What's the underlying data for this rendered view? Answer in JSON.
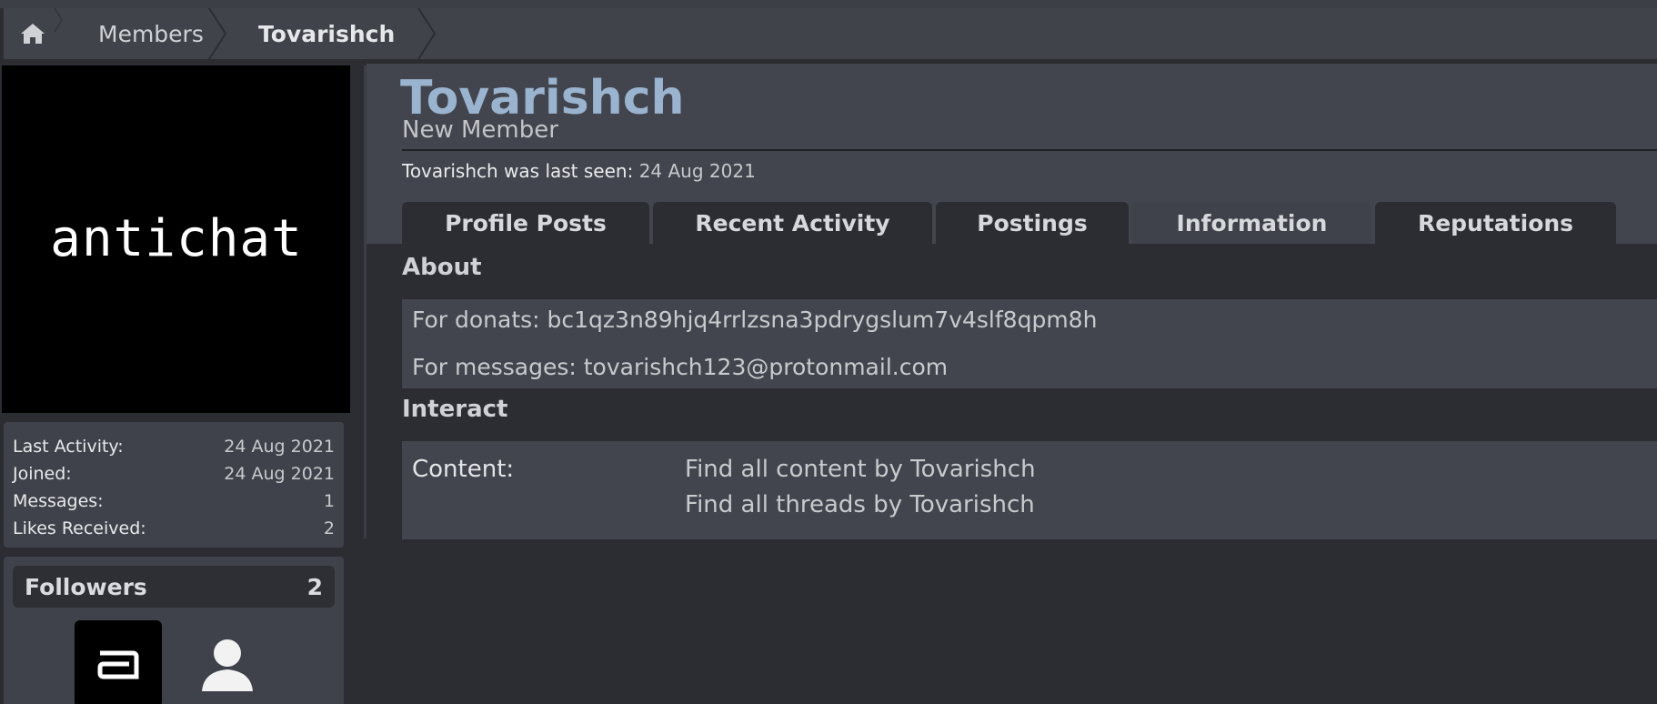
{
  "breadcrumb": {
    "home_icon": "home-icon",
    "members": "Members",
    "current": "Tovarishch"
  },
  "sidebar": {
    "avatar_text": "antichat",
    "stats": [
      {
        "label": "Last Activity:",
        "value": "24 Aug 2021"
      },
      {
        "label": "Joined:",
        "value": "24 Aug 2021"
      },
      {
        "label": "Messages:",
        "value": "1"
      },
      {
        "label": "Likes Received:",
        "value": "2"
      }
    ],
    "followers": {
      "title": "Followers",
      "count": "2",
      "items": [
        {
          "icon": "antichat-a-avatar"
        },
        {
          "icon": "default-user-avatar"
        }
      ]
    }
  },
  "profile": {
    "username": "Tovarishch",
    "user_title": "New Member",
    "last_seen_label": "Tovarishch was last seen:",
    "last_seen_date": "24 Aug 2021",
    "tabs": [
      {
        "label": "Profile Posts",
        "active": false
      },
      {
        "label": "Recent Activity",
        "active": false
      },
      {
        "label": "Postings",
        "active": false
      },
      {
        "label": "Information",
        "active": true
      },
      {
        "label": "Reputations",
        "active": false
      }
    ],
    "about": {
      "title": "About",
      "lines": [
        "For donats: bc1qz3n89hjq4rrlzsna3pdrygslum7v4slf8qpm8h",
        "For messages: tovarishch123@protonmail.com"
      ]
    },
    "interact": {
      "title": "Interact",
      "content_label": "Content:",
      "links": [
        "Find all content by Tovarishch",
        "Find all threads by Tovarishch"
      ]
    }
  },
  "colors": {
    "background": "#2b2d32",
    "panel": "#42454d",
    "username": "#9ab3cf",
    "avatar_bg": "#000000"
  }
}
